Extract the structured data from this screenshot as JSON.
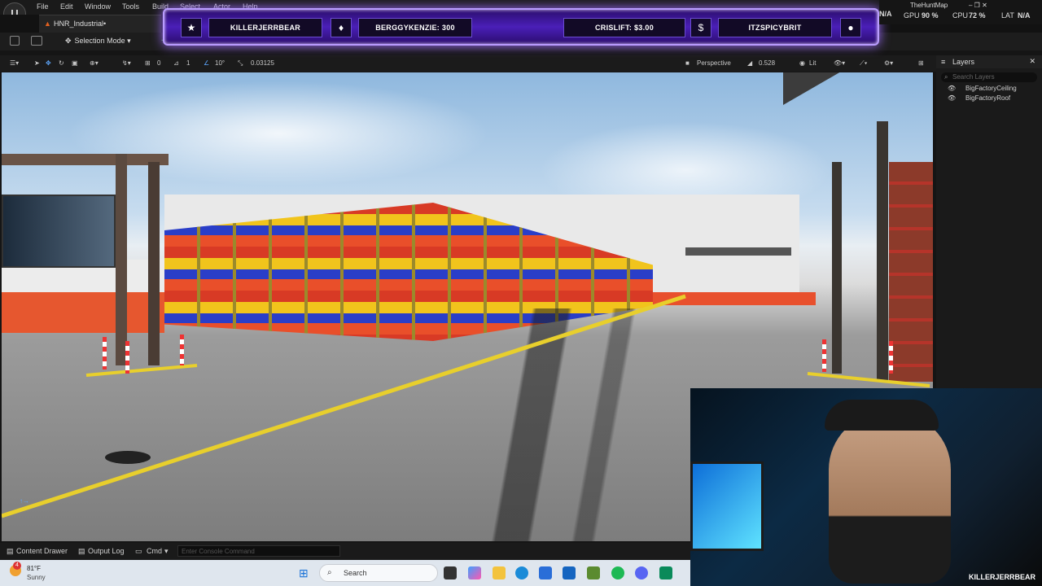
{
  "menu": {
    "items": [
      "File",
      "Edit",
      "Window",
      "Tools",
      "Build",
      "Select",
      "Actor",
      "Help"
    ]
  },
  "level_tab": {
    "label": "HNR_Industrial•"
  },
  "toolbar": {
    "selection_mode": "Selection Mode",
    "snap_rotation": "10°",
    "snap_scale": "0.03125",
    "grid_a": "0",
    "grid_b": "1",
    "perspective": "Perspective",
    "fov": "0.528",
    "lit": "Lit"
  },
  "stream_bar": {
    "follower": "KILLERJERRBEAR",
    "bits": "BERGGYKENZIE: 300",
    "tip": "CRISLIFT: $3.00",
    "sub": "ITZSPICYBRIT",
    "icons": {
      "follower": "star-icon",
      "bits": "diamond-icon",
      "tip": "dollar-icon",
      "sub": "user-icon"
    }
  },
  "perf": {
    "na": "N/A",
    "project": "TheHuntMap",
    "gpu_label": "GPU",
    "gpu_value": "90 %",
    "cpu_label": "CPU",
    "cpu_value": "72 %",
    "lat_label": "LAT",
    "lat_value": "N/A"
  },
  "layers": {
    "title": "Layers",
    "search_placeholder": "Search Layers",
    "items": [
      "BigFactoryCeiling",
      "BigFactoryRoof"
    ]
  },
  "bottom": {
    "content_drawer": "Content Drawer",
    "output_log": "Output Log",
    "cmd": "Cmd",
    "console_placeholder": "Enter Console Command"
  },
  "taskbar": {
    "weather_temp": "81°F",
    "weather_desc": "Sunny",
    "search": "Search",
    "notification_count": "4"
  },
  "webcam": {
    "name": "KILLERJERRBEAR"
  },
  "colors": {
    "accent": "#8a5cff",
    "stream_bg": "#2b0d6e",
    "ue_dark": "#1a1a1a"
  }
}
